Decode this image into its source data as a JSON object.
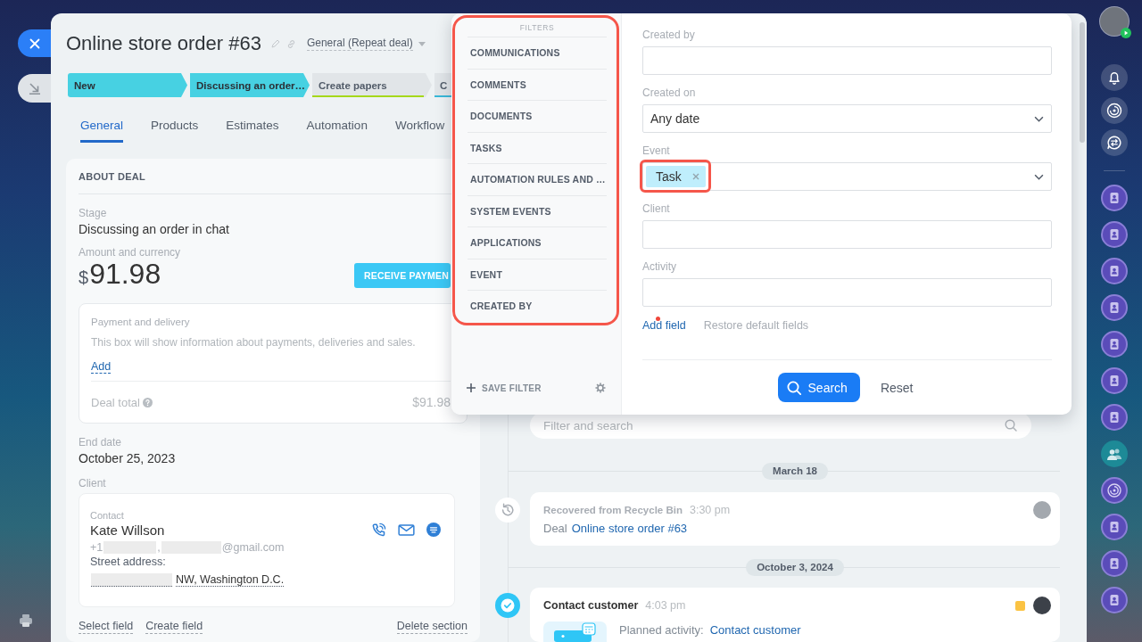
{
  "deal": {
    "title": "Online store order #63",
    "category": "General (Repeat deal)",
    "stages": [
      {
        "label": "New",
        "reached": true,
        "color": "#47d1e2"
      },
      {
        "label": "Discussing an order…",
        "reached": true,
        "color": "#47d1e2"
      },
      {
        "label": "Create papers",
        "reached": false,
        "color": "#a5d81a"
      },
      {
        "label": "C",
        "reached": false,
        "color": "#39b8d8"
      }
    ],
    "tabs": [
      {
        "label": "General",
        "selected": true
      },
      {
        "label": "Products",
        "selected": false
      },
      {
        "label": "Estimates",
        "selected": false
      },
      {
        "label": "Automation",
        "selected": false
      },
      {
        "label": "Workflow",
        "selected": false
      }
    ]
  },
  "about": {
    "heading": "ABOUT DEAL",
    "stage_label": "Stage",
    "stage_value": "Discussing an order in chat",
    "amount_label": "Amount and currency",
    "currency": "$",
    "amount": "91.98",
    "payment_button": "RECEIVE PAYMEN",
    "payment_box": {
      "title": "Payment and delivery",
      "text": "This box will show information about payments, deliveries and sales.",
      "add_link": "Add",
      "total_label": "Deal total",
      "total_value": "$91.98"
    },
    "end_date_label": "End date",
    "end_date": "October 25, 2023",
    "client_label": "Client",
    "contact": {
      "label": "Contact",
      "name": "Kate Willson",
      "phone": "+1",
      "separator": ",",
      "email": "@gmail.com",
      "redacted": true,
      "address_label": "Street address:",
      "address": "NW, Washington D.C."
    },
    "links": [
      "Select field",
      "Create field"
    ],
    "delete_link": "Delete section"
  },
  "timeline": {
    "search_placeholder": "Filter and search",
    "groups": [
      {
        "date": "March 18",
        "entries": [
          {
            "kind": "history",
            "title": "Recovered from Recycle Bin",
            "time": "3:30 pm",
            "prefix": "Deal",
            "link": "Online store order #63"
          }
        ]
      },
      {
        "date": "October 3, 2024",
        "entries": [
          {
            "kind": "task",
            "title": "Contact customer",
            "time": "4:03 pm",
            "color": "#fbc343",
            "prefix": "Planned activity:",
            "link": "Contact customer"
          }
        ]
      }
    ]
  },
  "filter": {
    "heading": "FILTERS",
    "highlighted": true,
    "presets": [
      "COMMUNICATIONS",
      "COMMENTS",
      "DOCUMENTS",
      "TASKS",
      "AUTOMATION RULES AND …",
      "SYSTEM EVENTS",
      "APPLICATIONS",
      "EVENT",
      "CREATED BY"
    ],
    "save_filter": "SAVE FILTER",
    "fields": [
      {
        "label": "Created by",
        "kind": "text"
      },
      {
        "label": "Created on",
        "kind": "select",
        "value": "Any date"
      },
      {
        "label": "Event",
        "kind": "tags",
        "tags": [
          {
            "label": "Task",
            "highlighted": true
          }
        ]
      },
      {
        "label": "Client",
        "kind": "text"
      },
      {
        "label": "Activity",
        "kind": "text"
      }
    ],
    "add_field": {
      "label": "Add field",
      "dot": true
    },
    "restore_fields": "Restore default fields",
    "search_button": "Search",
    "reset_button": "Reset"
  }
}
